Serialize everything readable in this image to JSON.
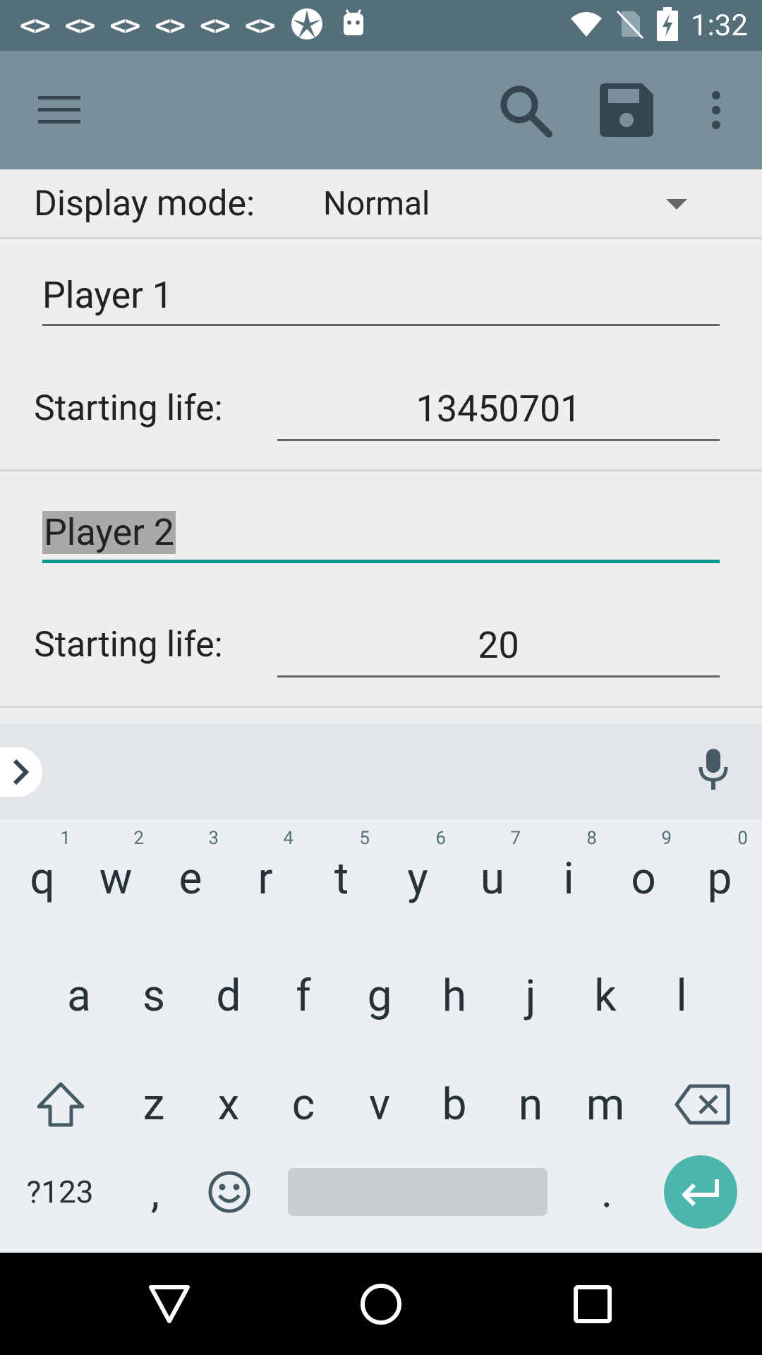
{
  "status_bar": {
    "code_icons": [
      "<>",
      "<>",
      "<>",
      "<>",
      "<>",
      "<>"
    ],
    "time": "1:32"
  },
  "form": {
    "display_mode_label": "Display mode:",
    "display_mode_value": "Normal",
    "players": [
      {
        "name": "Player 1",
        "starting_life_label": "Starting life:",
        "starting_life": "13450701"
      },
      {
        "name": "Player 2",
        "starting_life_label": "Starting life:",
        "starting_life": "20"
      }
    ]
  },
  "keyboard": {
    "row1": [
      {
        "k": "q",
        "h": "1"
      },
      {
        "k": "w",
        "h": "2"
      },
      {
        "k": "e",
        "h": "3"
      },
      {
        "k": "r",
        "h": "4"
      },
      {
        "k": "t",
        "h": "5"
      },
      {
        "k": "y",
        "h": "6"
      },
      {
        "k": "u",
        "h": "7"
      },
      {
        "k": "i",
        "h": "8"
      },
      {
        "k": "o",
        "h": "9"
      },
      {
        "k": "p",
        "h": "0"
      }
    ],
    "row2": [
      "a",
      "s",
      "d",
      "f",
      "g",
      "h",
      "j",
      "k",
      "l"
    ],
    "row3": [
      "z",
      "x",
      "c",
      "v",
      "b",
      "n",
      "m"
    ],
    "symbols_key": "?123",
    "comma_key": ",",
    "period_key": "."
  },
  "colors": {
    "status_bar": "#546e7a",
    "toolbar": "#78909c",
    "accent": "#009688",
    "enter_key": "#4db6ac"
  }
}
